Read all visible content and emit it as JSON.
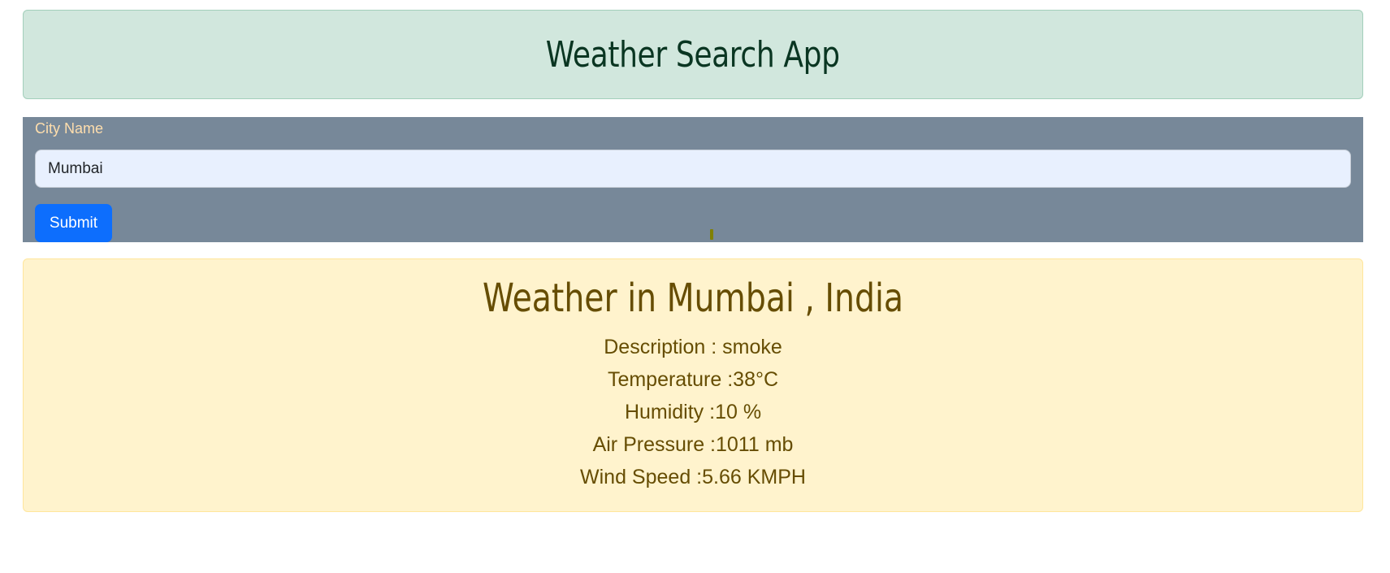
{
  "header": {
    "title": "Weather Search App"
  },
  "form": {
    "city_label": "City Name",
    "city_value": "Mumbai",
    "submit_label": "Submit"
  },
  "result": {
    "title": "Weather in Mumbai , India",
    "description": "Description : smoke",
    "temperature": "Temperature :38°C",
    "humidity": "Humidity :10 %",
    "pressure": "Air Pressure :1011 mb",
    "wind": "Wind Speed :5.66 KMPH"
  },
  "colors": {
    "header_bg": "#d1e7dd",
    "header_text": "#0a3622",
    "panel_bg": "#778899",
    "label_text": "#ffdead",
    "input_bg": "#e8f0fe",
    "button_bg": "#0d6efd",
    "result_bg": "#fff3cd",
    "result_text": "#664d03"
  }
}
